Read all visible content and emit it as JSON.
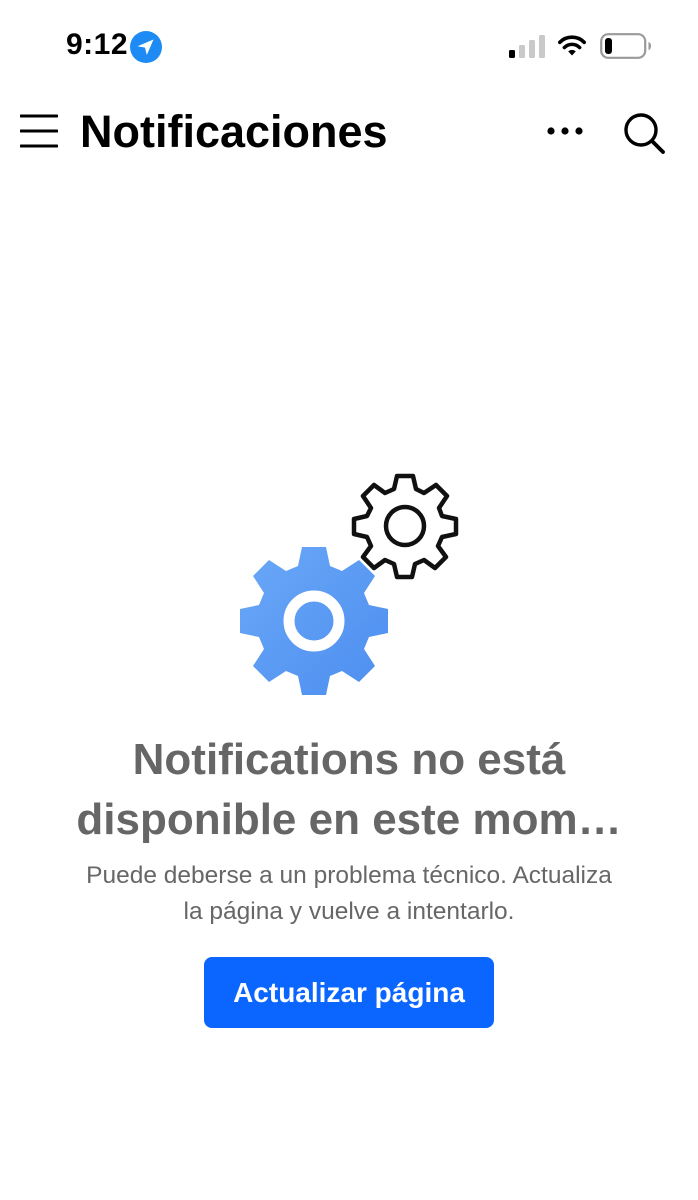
{
  "status_bar": {
    "time": "9:12",
    "icons": [
      "location-arrow-icon",
      "cellular-signal-icon",
      "wifi-icon",
      "battery-icon"
    ]
  },
  "header": {
    "title": "Notificaciones",
    "icons": [
      "hamburger-menu-icon",
      "more-icon",
      "search-icon"
    ]
  },
  "empty_state": {
    "illustration": "gears-icon",
    "title_lines": [
      "Notifications no está",
      "disponible en este mom…"
    ],
    "subtitle_lines": [
      "Puede deberse a un problema técnico. Actualiza",
      "la página y vuelve a intentarlo."
    ],
    "button_label": "Actualizar página"
  },
  "colors": {
    "accent": "#0a66ff",
    "title_gray": "#666666",
    "text_gray": "#676767",
    "gear_blue": "#5b9cf5"
  }
}
